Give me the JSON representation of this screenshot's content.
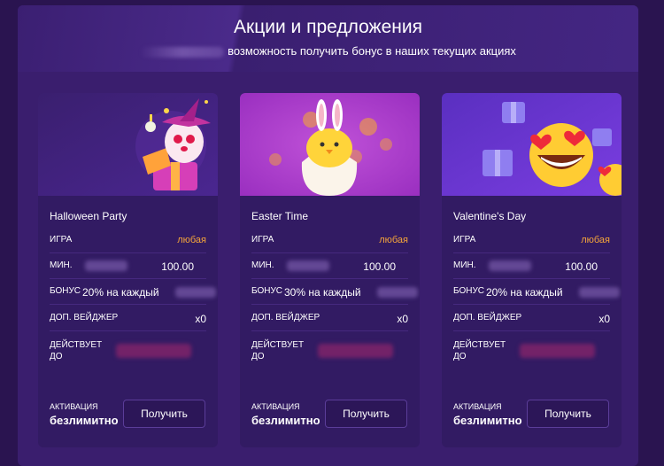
{
  "header": {
    "title": "Акции и предложения",
    "subtitle": "возможность получить бонус в наших текущих акциях"
  },
  "labels": {
    "game": "ИГРА",
    "min": "МИН.",
    "bonus": "БОНУС",
    "extra_wager": "ДОП. ВЕЙДЖЕР",
    "valid_until_line1": "ДЕЙСТВУЕТ",
    "valid_until_line2": "ДО",
    "activation": "АКТИВАЦИЯ",
    "get_button": "Получить"
  },
  "cards": [
    {
      "title": "Halloween Party",
      "game": "любая",
      "min": "100.00",
      "bonus": "20% на каждый",
      "extra_wager": "x0",
      "activation": "безлимитно",
      "image_icon": "halloween-ghost-gift-icon"
    },
    {
      "title": "Easter Time",
      "game": "любая",
      "min": "100.00",
      "bonus": "30% на каждый",
      "extra_wager": "x0",
      "activation": "безлимитно",
      "image_icon": "easter-chick-egg-icon"
    },
    {
      "title": "Valentine's Day",
      "game": "любая",
      "min": "100.00",
      "bonus": "20% на каждый",
      "extra_wager": "x0",
      "activation": "безлимитно",
      "image_icon": "heart-eyes-emoji-icon"
    }
  ],
  "colors": {
    "background": "#2a1450",
    "panel": "#3a1e6e",
    "card": "#321b63",
    "accent_orange": "#f5a53a"
  }
}
